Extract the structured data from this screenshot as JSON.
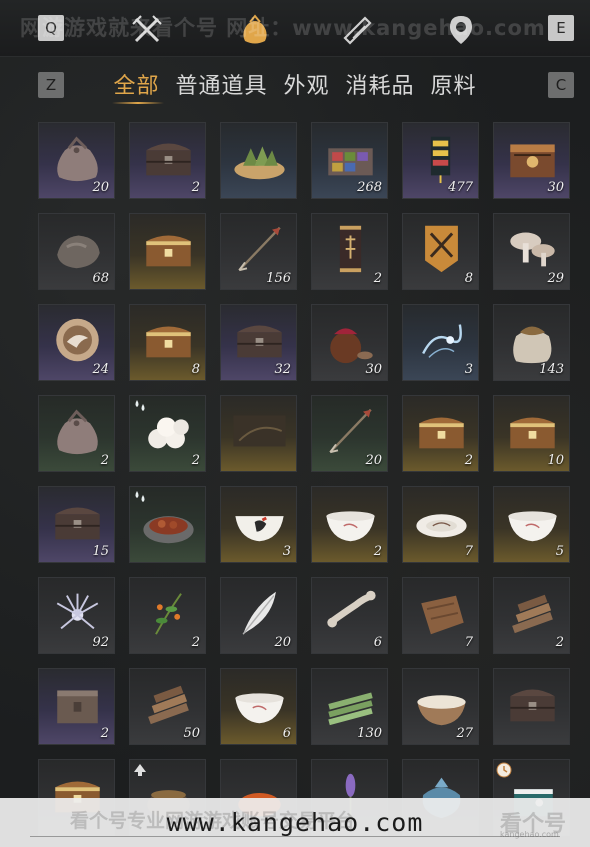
{
  "header": {
    "keys": {
      "q": "Q",
      "e": "E",
      "z": "Z",
      "c": "C"
    },
    "watermark": "网游游戏就来看个号 网址：www.kangehao.com",
    "icons": [
      "crossed-swords-icon",
      "money-pouch-icon",
      "scroll-icon",
      "location-pin-icon"
    ]
  },
  "tabs": [
    {
      "label": "全部",
      "active": true
    },
    {
      "label": "普通道具",
      "active": false
    },
    {
      "label": "外观",
      "active": false
    },
    {
      "label": "消耗品",
      "active": false
    },
    {
      "label": "原料",
      "active": false
    }
  ],
  "items": [
    {
      "icon": "cloth-pouch-icon",
      "quality": "purple",
      "quantity": "20"
    },
    {
      "icon": "dark-chest-icon",
      "quality": "purple",
      "quantity": "2"
    },
    {
      "icon": "zongzi-basket-icon",
      "quality": "blue",
      "quantity": ""
    },
    {
      "icon": "spice-box-icon",
      "quality": "blue",
      "quantity": "268"
    },
    {
      "icon": "talisman-charm-icon",
      "quality": "purple",
      "quantity": "477"
    },
    {
      "icon": "ornate-chest-icon",
      "quality": "purple",
      "quantity": "30"
    },
    {
      "icon": "ore-stone-icon",
      "quality": "gray",
      "quantity": "68"
    },
    {
      "icon": "golden-chest-icon",
      "quality": "gold",
      "quantity": ""
    },
    {
      "icon": "arrow-icon",
      "quality": "gray",
      "quantity": "156"
    },
    {
      "icon": "banner-scroll-icon",
      "quality": "gray",
      "quantity": "2"
    },
    {
      "icon": "sword-banner-icon",
      "quality": "gray",
      "quantity": "8"
    },
    {
      "icon": "mushroom-icon",
      "quality": "gray",
      "quantity": "29"
    },
    {
      "icon": "bird-medallion-icon",
      "quality": "purple",
      "quantity": "24"
    },
    {
      "icon": "golden-chest-icon",
      "quality": "gold",
      "quantity": "8"
    },
    {
      "icon": "dark-chest-icon",
      "quality": "purple",
      "quantity": "32"
    },
    {
      "icon": "wine-jars-icon",
      "quality": "gray",
      "quantity": "30"
    },
    {
      "icon": "spirit-wisp-icon",
      "quality": "blue",
      "quantity": "3"
    },
    {
      "icon": "grain-sack-icon",
      "quality": "gray",
      "quantity": "143"
    },
    {
      "icon": "cloth-pouch-icon",
      "quality": "green",
      "quantity": "2"
    },
    {
      "icon": "steamed-buns-icon",
      "quality": "green",
      "quantity": "2",
      "tag": "consumable-drops-icon"
    },
    {
      "icon": "dark-slab-icon",
      "quality": "gold",
      "quantity": ""
    },
    {
      "icon": "arrow-icon",
      "quality": "green",
      "quantity": "20"
    },
    {
      "icon": "golden-chest-icon",
      "quality": "gold",
      "quantity": "2"
    },
    {
      "icon": "golden-chest-icon",
      "quality": "gold",
      "quantity": "10"
    },
    {
      "icon": "dark-chest-icon",
      "quality": "purple",
      "quantity": "15"
    },
    {
      "icon": "braised-dish-icon",
      "quality": "green",
      "quantity": "",
      "tag": "consumable-drops-icon"
    },
    {
      "icon": "rooster-bowl-icon",
      "quality": "gold",
      "quantity": "3"
    },
    {
      "icon": "porcelain-bowl-icon",
      "quality": "gold",
      "quantity": "2"
    },
    {
      "icon": "porcelain-plate-icon",
      "quality": "gold",
      "quantity": "7"
    },
    {
      "icon": "porcelain-bowl-icon",
      "quality": "gold",
      "quantity": "5"
    },
    {
      "icon": "spider-lily-icon",
      "quality": "gray",
      "quantity": "92"
    },
    {
      "icon": "herb-sprig-icon",
      "quality": "gray",
      "quantity": "2"
    },
    {
      "icon": "feather-icon",
      "quality": "gray",
      "quantity": "20"
    },
    {
      "icon": "bone-fragment-icon",
      "quality": "gray",
      "quantity": "6"
    },
    {
      "icon": "hide-leather-icon",
      "quality": "gray",
      "quantity": "7"
    },
    {
      "icon": "firewood-icon",
      "quality": "gray",
      "quantity": "2"
    },
    {
      "icon": "wooden-box-icon",
      "quality": "purple",
      "quantity": "2"
    },
    {
      "icon": "firewood-icon",
      "quality": "gray",
      "quantity": "50"
    },
    {
      "icon": "porcelain-bowl-icon",
      "quality": "gold",
      "quantity": "6"
    },
    {
      "icon": "bamboo-bundle-icon",
      "quality": "gray",
      "quantity": "130"
    },
    {
      "icon": "flour-bowl-icon",
      "quality": "gray",
      "quantity": "27"
    },
    {
      "icon": "dark-chest-icon",
      "quality": "gray",
      "quantity": ""
    },
    {
      "icon": "golden-chest-icon",
      "quality": "gray",
      "quantity": ""
    },
    {
      "icon": "clay-pot-icon",
      "quality": "gray",
      "quantity": "",
      "tag": "up-arrow-icon"
    },
    {
      "icon": "orange-fruit-icon",
      "quality": "gray",
      "quantity": ""
    },
    {
      "icon": "lavender-icon",
      "quality": "gray",
      "quantity": ""
    },
    {
      "icon": "blue-bundle-icon",
      "quality": "gray",
      "quantity": ""
    },
    {
      "icon": "gift-box-icon",
      "quality": "gray",
      "quantity": "",
      "tag": "timer-clock-icon"
    }
  ],
  "footer": {
    "url": "www.kangehao.com",
    "watermark": "看个号专业网游游戏账号交易平台",
    "logo": "看个号",
    "logo_sub": "kangehao.com"
  }
}
